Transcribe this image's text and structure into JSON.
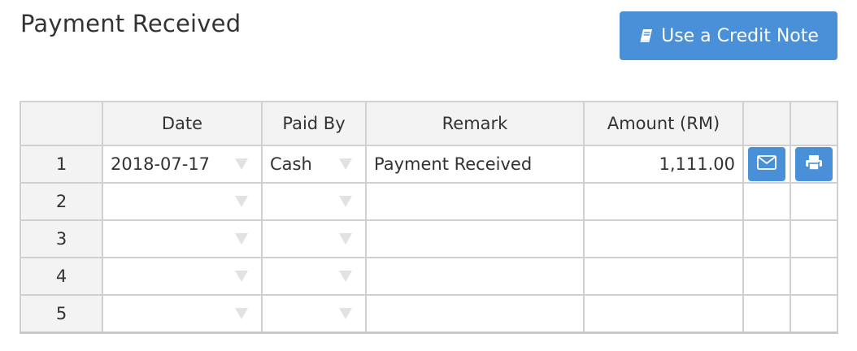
{
  "page": {
    "title": "Payment Received"
  },
  "actions": {
    "credit_note_label": "Use a Credit Note"
  },
  "table": {
    "headers": [
      "",
      "Date",
      "Paid By",
      "Remark",
      "Amount (RM)",
      "",
      ""
    ],
    "rows": [
      {
        "num": "1",
        "date": "2018-07-17",
        "paid_by": "Cash",
        "remark": "Payment Received",
        "amount": "1,111.00"
      },
      {
        "num": "2",
        "date": "",
        "paid_by": "",
        "remark": "",
        "amount": ""
      },
      {
        "num": "3",
        "date": "",
        "paid_by": "",
        "remark": "",
        "amount": ""
      },
      {
        "num": "4",
        "date": "",
        "paid_by": "",
        "remark": "",
        "amount": ""
      },
      {
        "num": "5",
        "date": "",
        "paid_by": "",
        "remark": "",
        "amount": ""
      }
    ]
  },
  "icons": {
    "credit_note": "book-icon",
    "email": "envelope-icon",
    "print": "printer-icon",
    "dropdown": "caret-down-icon"
  },
  "colors": {
    "accent": "#4a90d9",
    "header_bg": "#f3f3f3",
    "border": "#d0d0d0"
  }
}
